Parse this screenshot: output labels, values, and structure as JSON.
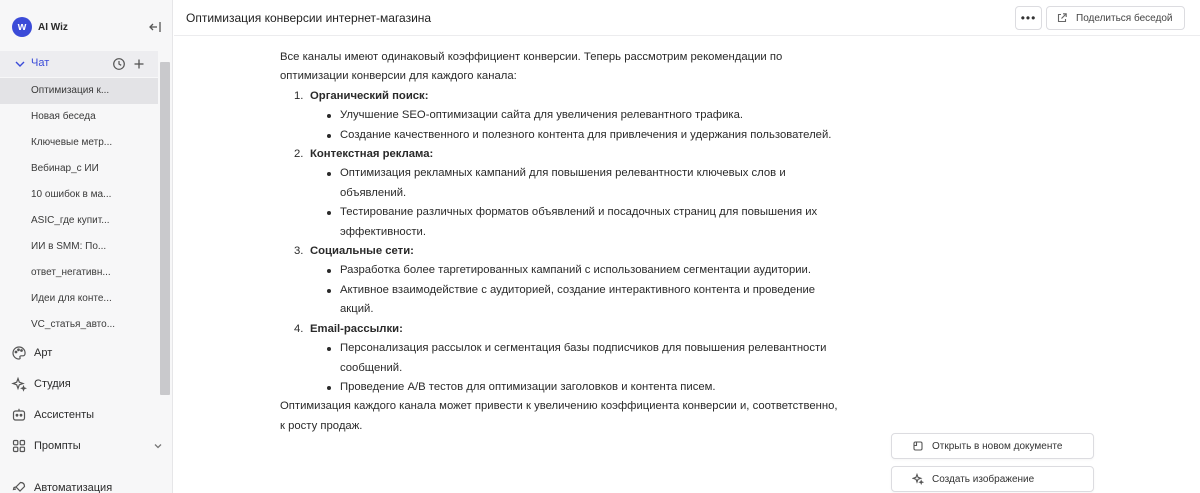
{
  "brand": {
    "name": "AI Wiz",
    "logo_letter": "w"
  },
  "sidebar": {
    "chat_label": "Чат",
    "chats": [
      "Оптимизация к...",
      "Новая беседа",
      "Ключевые метр...",
      "Вебинар_с ИИ",
      "10 ошибок в ма...",
      "ASIC_где купит...",
      "ИИ в SMM: По...",
      "ответ_негативн...",
      "Идеи для конте...",
      "VC_статья_авто..."
    ],
    "nav": [
      {
        "label": "Арт",
        "icon": "palette-icon"
      },
      {
        "label": "Студия",
        "icon": "sparkle-icon"
      },
      {
        "label": "Ассистенты",
        "icon": "bot-icon"
      },
      {
        "label": "Промпты",
        "icon": "grid-icon"
      },
      {
        "label": "Автоматизация",
        "icon": "rocket-icon"
      }
    ]
  },
  "header": {
    "title": "Оптимизация конверсии интернет-магазина",
    "more_label": "•••",
    "share_label": "Поделиться беседой"
  },
  "message": {
    "intro": "Все каналы имеют одинаковый коэффициент конверсии. Теперь рассмотрим рекомендации по оптимизации конверсии для каждого канала:",
    "items": [
      {
        "num": "1.",
        "title": "Органический поиск:",
        "bullets": [
          "Улучшение SEO-оптимизации сайта для увеличения релевантного трафика.",
          "Создание качественного и полезного контента для привлечения и удержания пользователей."
        ]
      },
      {
        "num": "2.",
        "title": "Контекстная реклама:",
        "bullets": [
          "Оптимизация рекламных кампаний для повышения релевантности ключевых слов и объявлений.",
          "Тестирование различных форматов объявлений и посадочных страниц для повышения их эффективности."
        ]
      },
      {
        "num": "3.",
        "title": "Социальные сети:",
        "bullets": [
          "Разработка более таргетированных кампаний с использованием сегментации аудитории.",
          "Активное взаимодействие с аудиторией, создание интерактивного контента и проведение акций."
        ]
      },
      {
        "num": "4.",
        "title": "Email-рассылки:",
        "bullets": [
          "Персонализация рассылок и сегментация базы подписчиков для повышения релевантности сообщений.",
          "Проведение A/B тестов для оптимизации заголовков и контента писем."
        ]
      }
    ],
    "outro": "Оптимизация каждого канала может привести к увеличению коэффициента конверсии и, соответственно, к росту продаж."
  },
  "actions": {
    "open_doc": "Открыть в новом документе",
    "create_image": "Создать изображение"
  },
  "colors": {
    "accent": "#3b4bd8",
    "sidebar_bg": "#f7f7f8"
  }
}
